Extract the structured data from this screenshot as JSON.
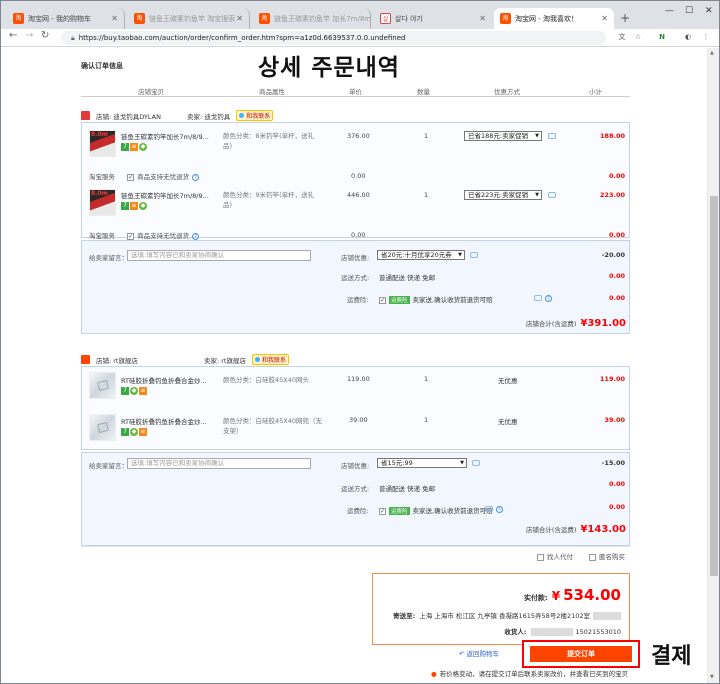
{
  "browser": {
    "tabs": [
      {
        "icon": "淘",
        "label": "淘宝网 - 我的购物车"
      },
      {
        "icon": "淘",
        "label": "链鱼王碳素钓鱼竿 淘宝搜索"
      },
      {
        "icon": "淘",
        "label": "链鱼王碳素钓鱼竿 加长7m/8m"
      },
      {
        "icon": "살",
        "label": "살다 야기"
      },
      {
        "icon": "淘",
        "label": "淘宝网 - 淘我喜欢！"
      }
    ],
    "url": "https://buy.taobao.com/auction/order/confirm_order.htm?spm=a1z0d.6639537.0.0.undefined",
    "ext_labels": [
      "文",
      "☆",
      "N",
      "◐",
      "⋮"
    ]
  },
  "overlay": {
    "title_kr": "상세 주문내역",
    "pay_kr": "결제"
  },
  "page_title": "确认订单信息",
  "columns": [
    "店铺宝贝",
    "商品属性",
    "单价",
    "数量",
    "优惠方式",
    "小计"
  ],
  "shops": [
    {
      "shop_label": "店铺: 迪戈钓具DYLAN",
      "seller_label": "卖家: 迪戈钓具",
      "contact": "和我联系",
      "items": [
        {
          "name": "链鱼王碳素钓竿加长7m/8/9...",
          "attr": "颜色分类：8米钓竿(单杆，送礼品)",
          "price": "376.00",
          "qty": "1",
          "discount": "已省188元:卖家促销",
          "subtotal": "188.00"
        },
        {
          "name": "链鱼王碳素钓竿加长7m/8/9...",
          "attr": "颜色分类：9米钓竿(单杆，送礼品)",
          "price": "446.00",
          "qty": "1",
          "discount": "已省223元:卖家促销",
          "subtotal": "223.00"
        }
      ],
      "service_label": "淘宝服务",
      "service_text": "商品支持无忧退货",
      "service_price": "0.00",
      "service_sub": "0.00",
      "message_label": "给卖家留言：",
      "message_placeholder": "选填:填写内容已和卖家协商确认",
      "coupon_label": "店铺优惠:",
      "coupon_value": "省20元:十月优享20元券",
      "coupon_amount": "-20.00",
      "shipping_label": "运送方式:",
      "shipping_value": "普通配送 快递 免邮",
      "shipping_amount": "0.00",
      "insurance_label": "运费险:",
      "insurance_tag": "运费险",
      "insurance_text": "卖家送,确认收货前退货可赔",
      "insurance_amount": "0.00",
      "total_label": "店铺合计(含运费)",
      "total_value": "¥391.00"
    },
    {
      "shop_label": "店铺: rt旗舰店",
      "seller_label": "卖家: rt旗舰店",
      "contact": "和我联系",
      "items": [
        {
          "name": "RT硅胶折叠钓鱼折叠合金炒...",
          "attr": "颜色分类：白硅胶45X40网头",
          "price": "119.00",
          "qty": "1",
          "discount": "无优惠",
          "subtotal": "119.00"
        },
        {
          "name": "RT硅胶折叠钓鱼折叠合金炒...",
          "attr": "颜色分类：白硅胶45X40网兜（无支架）",
          "price": "39.00",
          "qty": "1",
          "discount": "无优惠",
          "subtotal": "39.00"
        }
      ],
      "message_label": "给卖家留言：",
      "message_placeholder": "选填:填写内容已和卖家协商确认",
      "coupon_label": "店铺优惠:",
      "coupon_value": "省15元:99",
      "coupon_amount": "-15.00",
      "shipping_label": "运送方式:",
      "shipping_value": "普通配送 快递 免邮",
      "shipping_amount": "0.00",
      "insurance_label": "运费险:",
      "insurance_tag": "运费险",
      "insurance_text": "卖家送,确认收货前退货可赔",
      "insurance_amount": "0.00",
      "total_label": "店铺合计(含运费)",
      "total_value": "¥143.00"
    }
  ],
  "options": {
    "agent_pay": "找人代付",
    "anonymous": "匿名购买"
  },
  "payment": {
    "real_label": "实付款:",
    "currency": "¥",
    "amount": "534.00",
    "ship_to_label": "寄送至:",
    "address": "上海 上海市 松江区 九亭镇 香凝路1615弄58号2楼2102室",
    "receiver_label": "收货人:",
    "phone": "15021553010"
  },
  "back_link": "返回购物车",
  "submit_label": "提交订单",
  "footer_note": "若价格变动，请在提交订单后联系卖家改价，并查看已买到的宝贝"
}
